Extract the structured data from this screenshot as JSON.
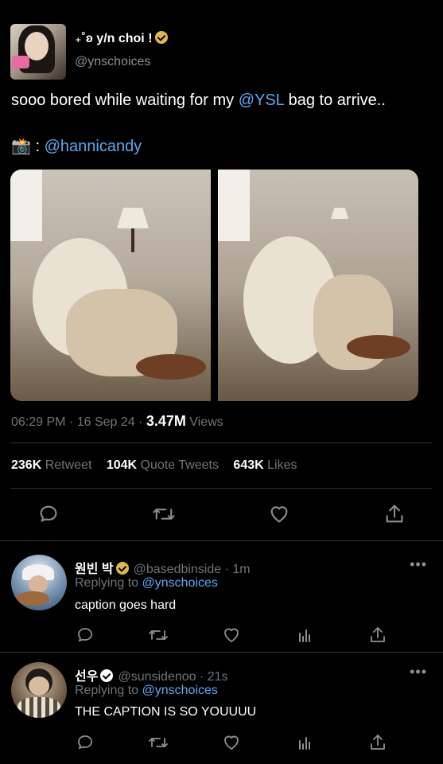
{
  "tweet": {
    "display_name": "₊˚ʚ y/n choi !",
    "handle": "@ynschoices",
    "text_before": "sooo bored while waiting for my ",
    "text_mention": "@YSL",
    "text_after": " bag to arrive..",
    "credit_emoji": "📸",
    "credit_sep": " : ",
    "credit_mention": "@hannicandy",
    "time": "06:29 PM · 16 Sep 24 · ",
    "views_count": "3.47M",
    "views_label": " Views",
    "retweets_count": "236K",
    "retweets_label": " Retweet",
    "quotes_count": "104K",
    "quotes_label": " Quote Tweets",
    "likes_count": "643K",
    "likes_label": " Likes",
    "verified_color": "#e0b84a"
  },
  "replies": [
    {
      "name": "원빈 박",
      "handle": "@basedbinside · 1m",
      "replying_prefix": "Replying to ",
      "replying_to": "@ynschoices",
      "text": "caption goes hard",
      "more": "•••"
    },
    {
      "name": "선우",
      "handle": "@sunsidenoo · 21s",
      "replying_prefix": "Replying to ",
      "replying_to": "@ynschoices",
      "text": "THE CAPTION IS SO YOUUUU",
      "more": "•••"
    }
  ],
  "icons": {
    "reply": "reply-icon",
    "retweet": "retweet-icon",
    "like": "heart-icon",
    "analytics": "analytics-icon",
    "share": "share-icon"
  },
  "colors": {
    "background": "#000000",
    "link": "#5aa9f0",
    "muted": "#6e7378",
    "divider": "#2f3336"
  }
}
